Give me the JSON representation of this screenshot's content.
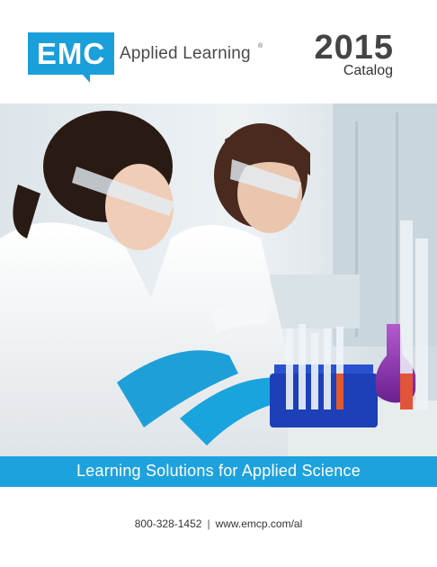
{
  "header": {
    "logo": {
      "mark": "EMC",
      "name": "Applied Learning",
      "reg": "®"
    },
    "year": "2015",
    "catalog_label": "Catalog"
  },
  "photo": {
    "subject": "lab-scientists-photo"
  },
  "banner": {
    "text": "Learning Solutions for Applied Science"
  },
  "footer": {
    "phone": "800-328-1452",
    "separator": "|",
    "url": "www.emcp.com/al"
  },
  "colors": {
    "brand_blue": "#1ea2dd",
    "text_gray": "#444444"
  }
}
